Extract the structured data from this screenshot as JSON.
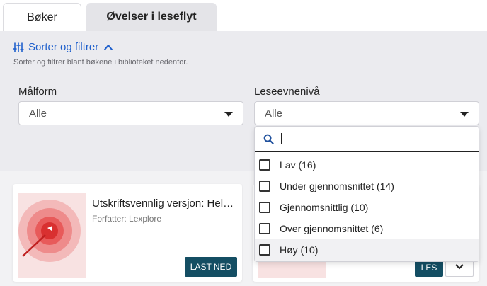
{
  "tabs": [
    {
      "label": "Bøker"
    },
    {
      "label": "Øvelser i leseflyt"
    }
  ],
  "filter": {
    "toggle_label": "Sorter og filtrer",
    "hint": "Sorter og filtrer blant bøkene i biblioteket nedenfor.",
    "malform": {
      "label": "Målform",
      "value": "Alle"
    },
    "leseevne": {
      "label": "Leseevnenivå",
      "value": "Alle"
    },
    "search": {
      "value": ""
    },
    "options": [
      {
        "label": "Lav (16)"
      },
      {
        "label": "Under gjennomsnittet (14)"
      },
      {
        "label": "Gjennomsnittlig (10)"
      },
      {
        "label": "Over gjennomsnittet (6)"
      },
      {
        "label": "Høy (10)"
      }
    ]
  },
  "cards": [
    {
      "title": "Utskriftsvennlig versjon: Hele rø...",
      "author": "Forfatter: Lexplore",
      "button": "LAST NED"
    },
    {
      "button": "LES"
    }
  ],
  "colors": {
    "accent": "#1e5fcc",
    "button_dark": "#144e63",
    "panel_bg": "#ebebef"
  }
}
